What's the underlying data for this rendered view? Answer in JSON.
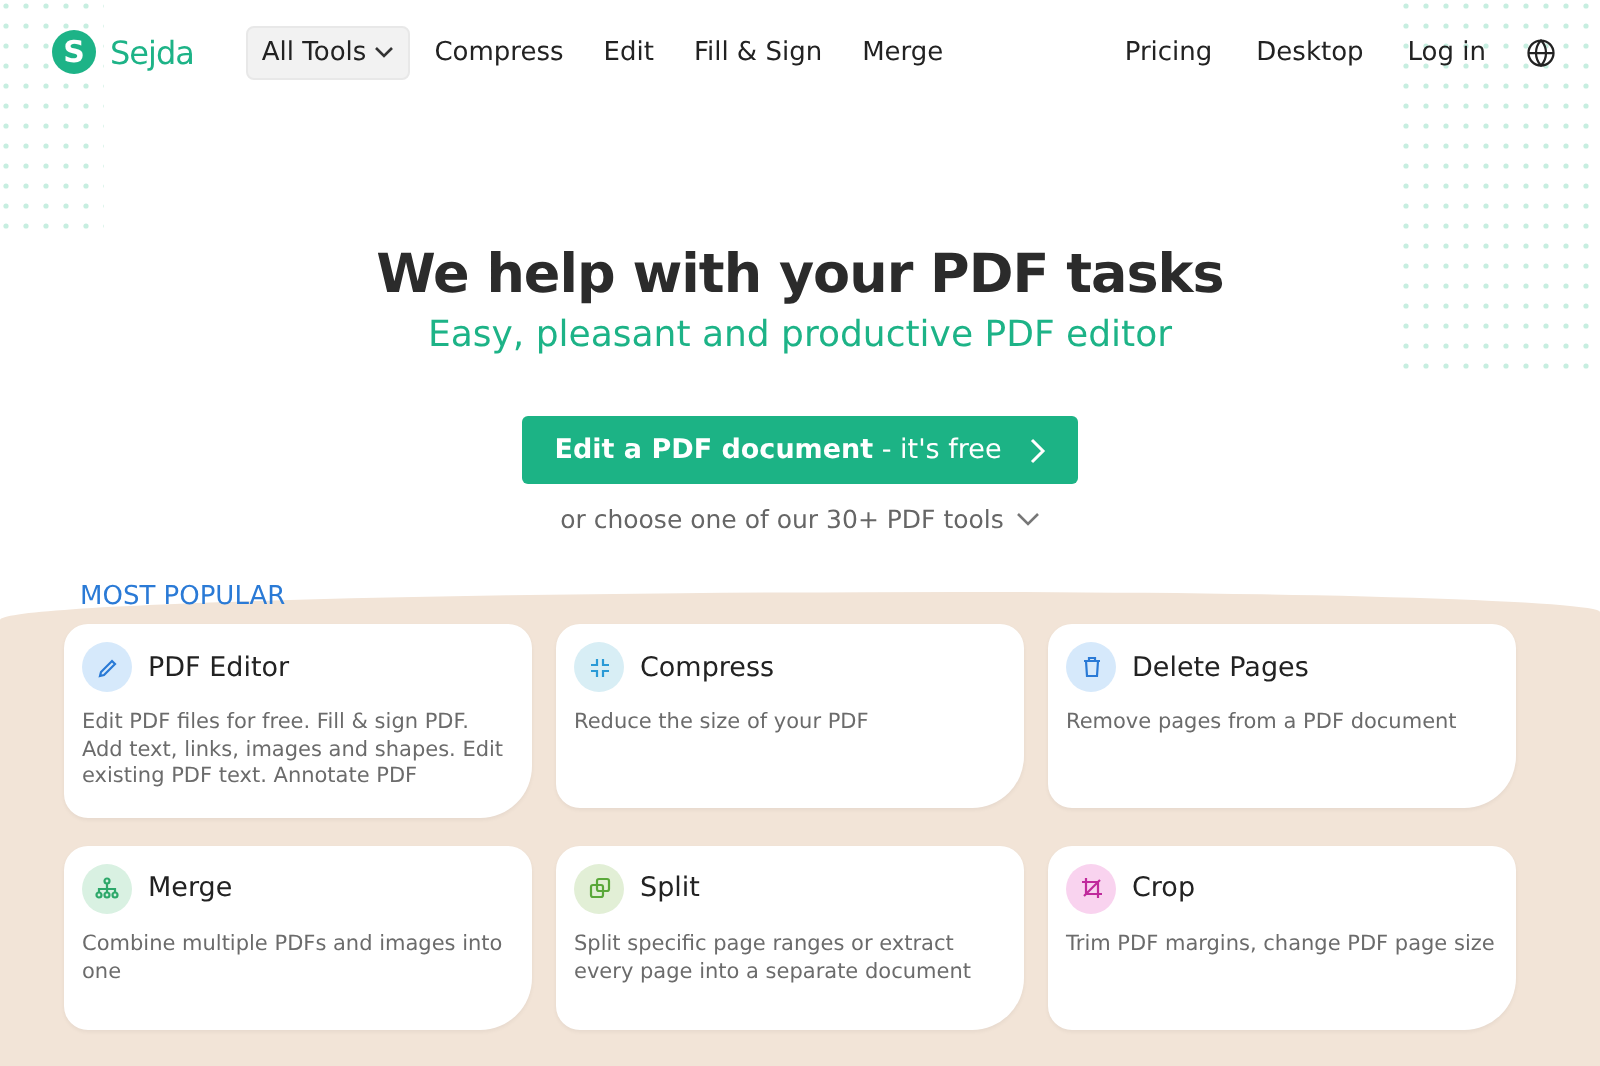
{
  "logo": {
    "text": "Sejda",
    "letter": "S"
  },
  "nav": [
    {
      "label": "All Tools",
      "kind": "dropdown"
    },
    {
      "label": "Compress",
      "kind": "link"
    },
    {
      "label": "Edit",
      "kind": "link"
    },
    {
      "label": "Fill & Sign",
      "kind": "link"
    },
    {
      "label": "Merge",
      "kind": "link"
    }
  ],
  "nav_right": [
    "Pricing",
    "Desktop",
    "Log in"
  ],
  "hero": {
    "title": "We help with your PDF tasks",
    "subtitle": "Easy, pleasant and productive PDF editor",
    "cta": "**Edit a PDF document** - it's free",
    "more": "or choose one of our 30+ PDF tools"
  },
  "section_title": "MOST POPULAR",
  "tools": [
    {
      "name": "PDF Editor",
      "description": "Edit PDF files for free. Fill & sign PDF. Add text, links, images and shapes. Edit existing PDF text. Annotate PDF",
      "kind": "pencil",
      "color": "#d6e9fb"
    },
    {
      "name": "Compress",
      "description": "Reduce the size of your PDF",
      "kind": "compress",
      "color": "#d8eef5"
    },
    {
      "name": "Delete Pages",
      "description": "Remove pages from a PDF document",
      "kind": "trash",
      "color": "#d6e9fb"
    },
    {
      "name": "Merge",
      "description": "Combine multiple PDFs and images into one",
      "kind": "merge",
      "color": "#d9f1e2"
    },
    {
      "name": "Split",
      "description": "Split specific page ranges or extract every page into a separate document",
      "kind": "split",
      "color": "#e2efd6"
    },
    {
      "name": "Crop",
      "description": "Trim PDF margins, change PDF page size",
      "kind": "crop",
      "color": "#f9d3ef"
    }
  ]
}
